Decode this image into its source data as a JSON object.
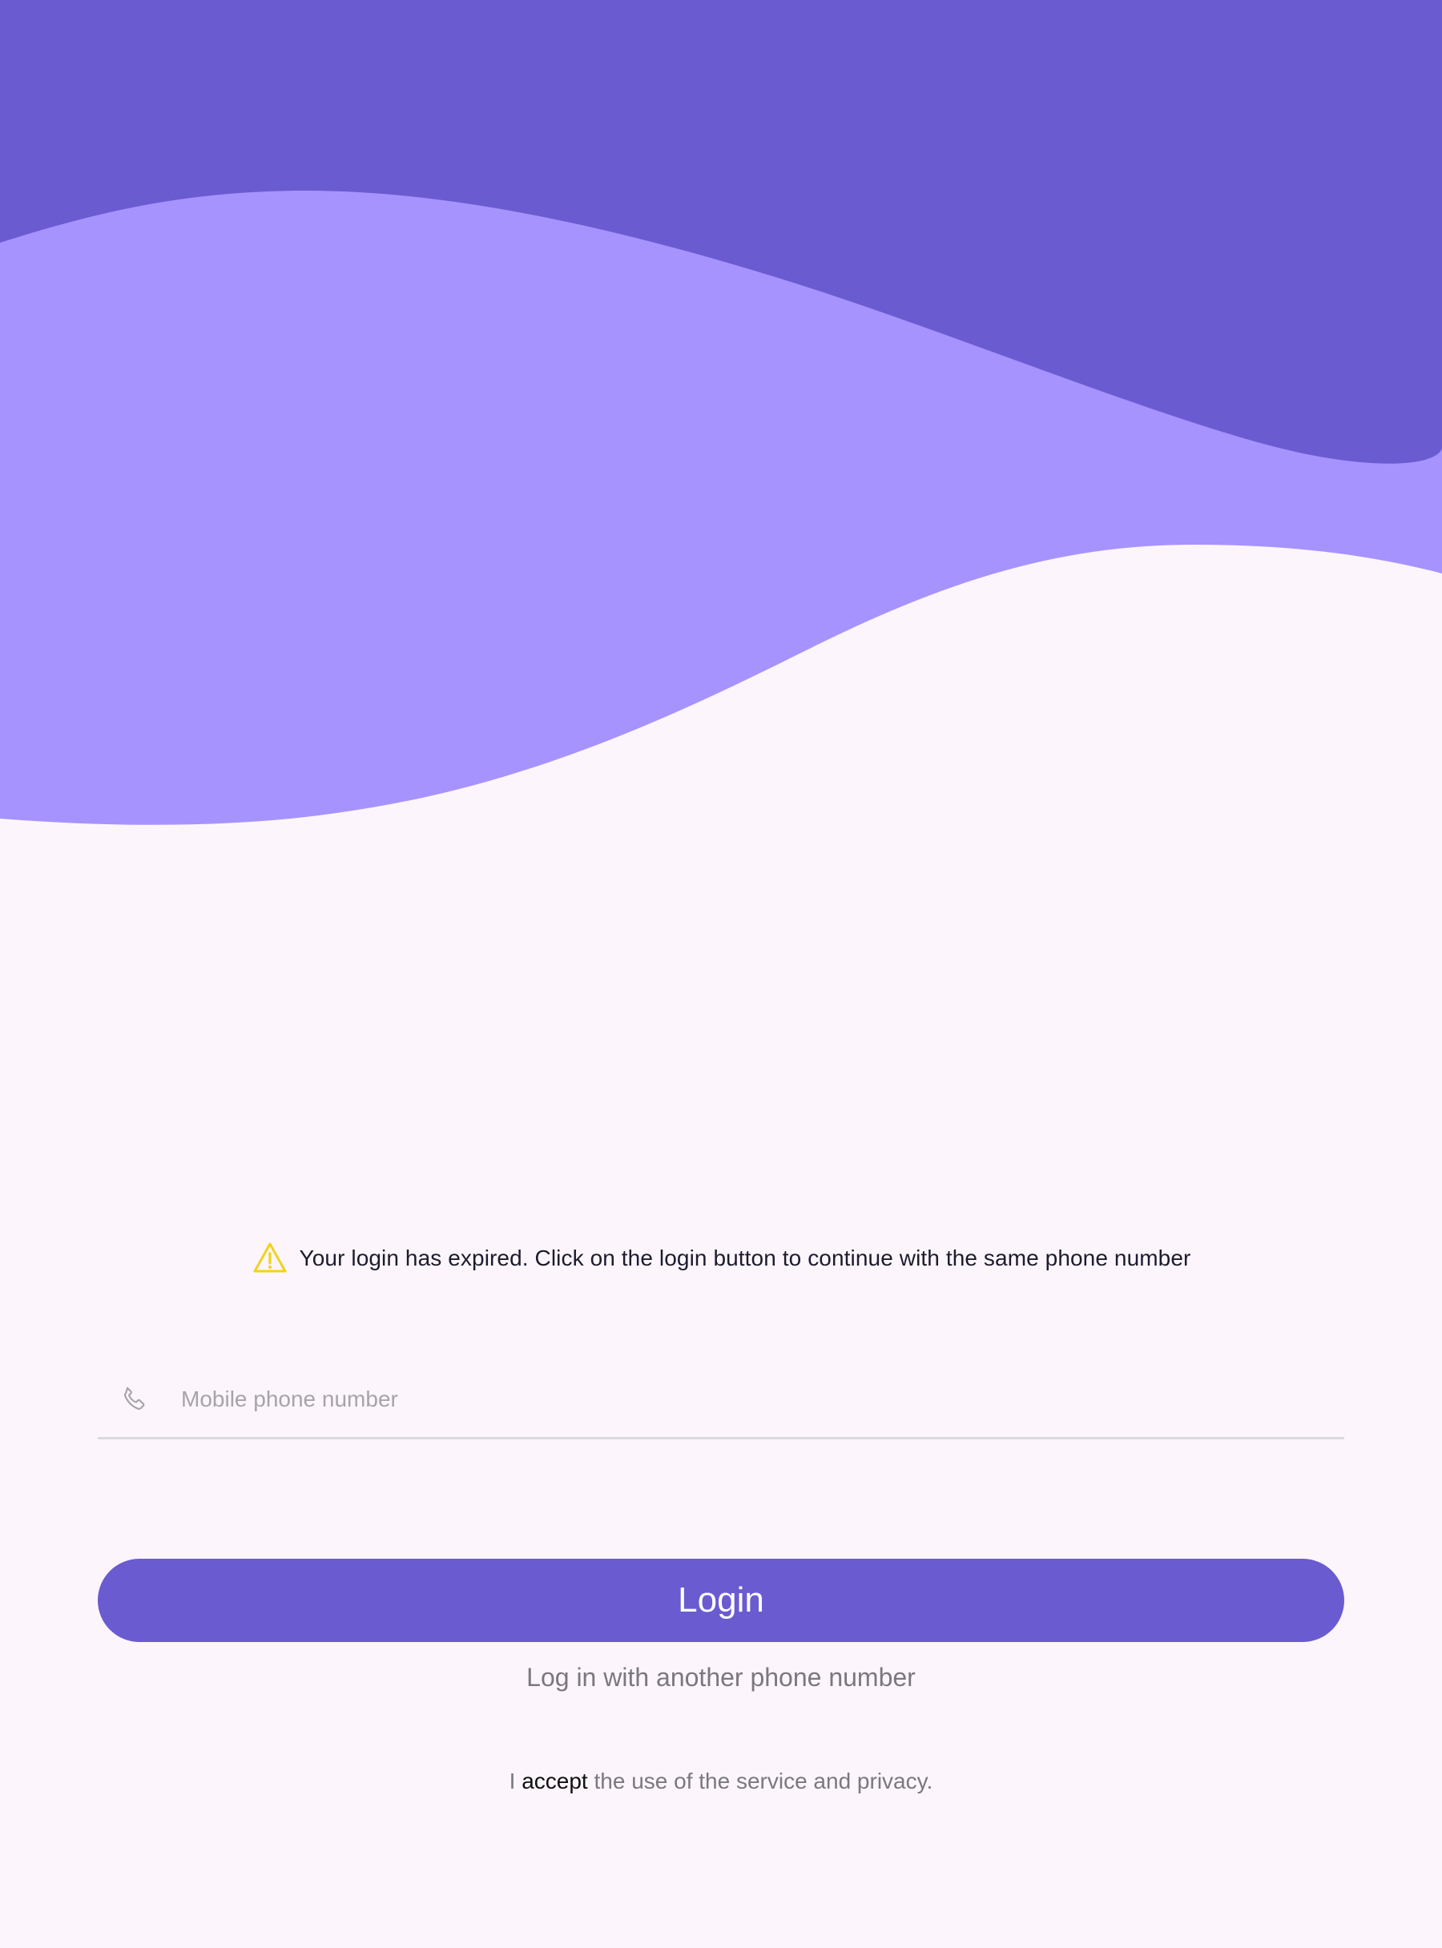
{
  "colors": {
    "background": "#fcf6fc",
    "wave_dark": "#6a5bd1",
    "wave_light": "#a793fd",
    "primary": "#6a5bd1",
    "warning_icon": "#f2d21b",
    "muted_text": "#7b7780"
  },
  "warning": {
    "icon": "warning-triangle-icon",
    "text": "Your login has expired. Click on the login button to continue with the same phone number"
  },
  "phone_field": {
    "icon": "phone-icon",
    "placeholder": "Mobile phone number",
    "value": ""
  },
  "login_button": {
    "label": "Login"
  },
  "alt_login": {
    "label": "Log in with another phone number"
  },
  "terms": {
    "prefix": "I",
    "link": "accept",
    "suffix": "the use of the service and privacy."
  }
}
